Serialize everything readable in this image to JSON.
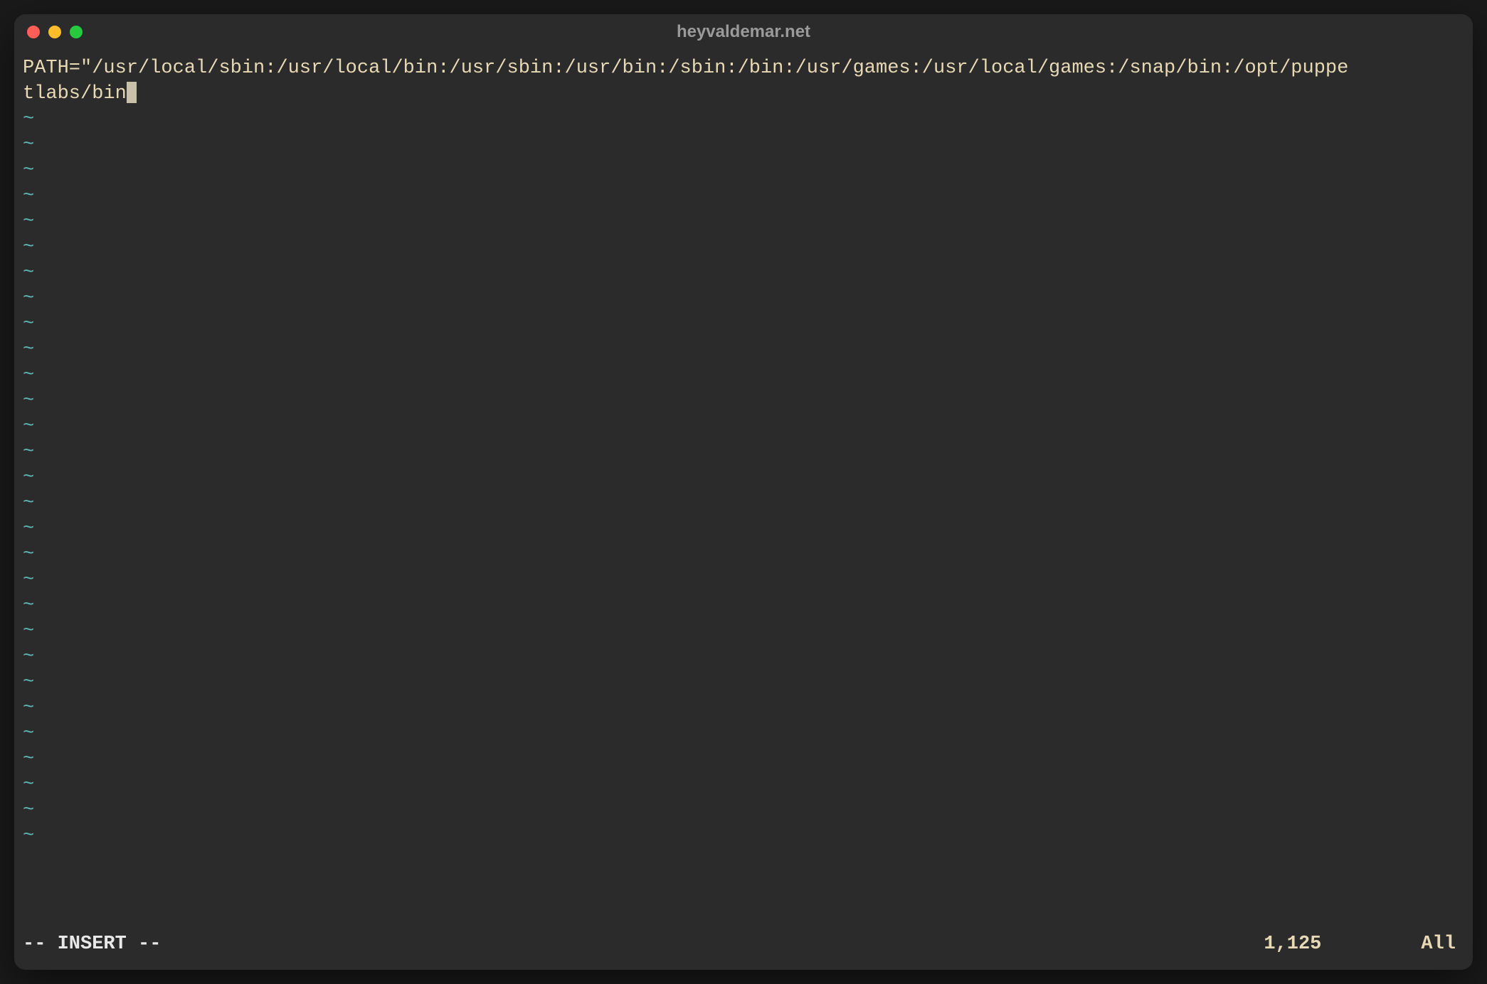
{
  "window": {
    "title": "heyvaldemar.net"
  },
  "editor": {
    "content_line1": "PATH=\"/usr/local/sbin:/usr/local/bin:/usr/sbin:/usr/bin:/sbin:/bin:/usr/games:/usr/local/games:/snap/bin:/opt/puppe",
    "content_line2": "tlabs/bin",
    "trailing_char": "\"",
    "tilde": "~",
    "tilde_count": 29
  },
  "status": {
    "mode": "-- INSERT --",
    "position": "1,125",
    "scroll": "All"
  },
  "colors": {
    "bg": "#2b2b2b",
    "text": "#e8d9b5",
    "tilde": "#5fb3b3",
    "title": "#9a9a9a"
  }
}
